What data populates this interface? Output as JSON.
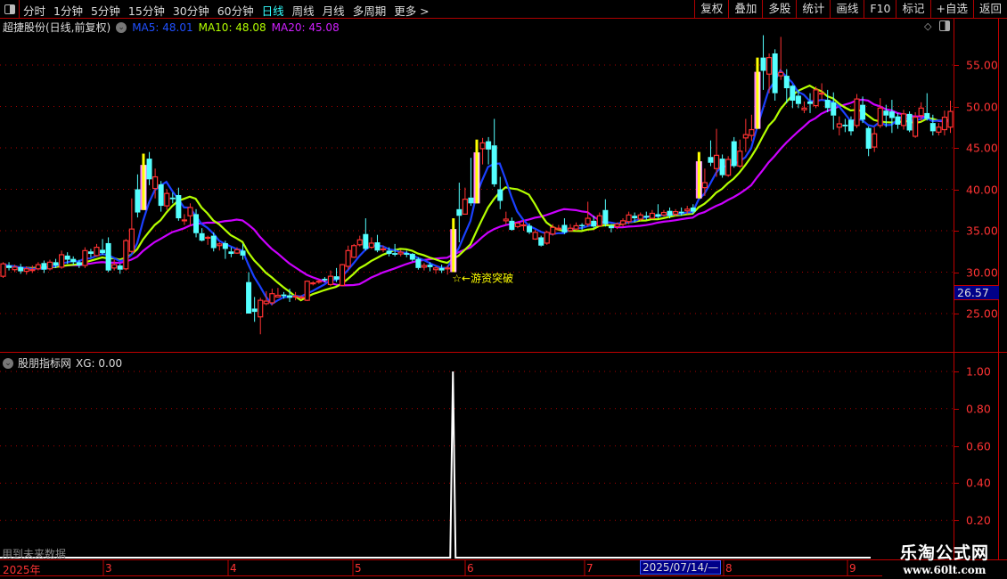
{
  "toolbar": {
    "periods": [
      "分时",
      "1分钟",
      "5分钟",
      "15分钟",
      "30分钟",
      "60分钟",
      "日线",
      "周线",
      "月线",
      "多周期",
      "更多 >"
    ],
    "active_period": "日线",
    "right_buttons": [
      "复权",
      "叠加",
      "多股",
      "统计",
      "画线",
      "F10",
      "标记",
      "+自选",
      "返回"
    ]
  },
  "main_panel": {
    "title": "超捷股份(日线,前复权)",
    "ma5": "MA5: 48.01",
    "ma10": "MA10: 48.08",
    "ma20": "MA20: 45.08",
    "signal_label": "☆←游资突破",
    "current_price": "26.57"
  },
  "sub_panel": {
    "title": "股朋指标网",
    "xg": "XG: 0.00",
    "future_note": "用到未来数据"
  },
  "colors": {
    "up": "#ff3232",
    "down": "#54ffff",
    "ma5": "#1a40ff",
    "ma10": "#b4ff00",
    "ma20": "#cc00ff",
    "signal": "#ffff00"
  },
  "watermark": {
    "title": "乐淘公式网",
    "url": "www.60lt.com"
  },
  "chart_data": [
    {
      "type": "candlestick",
      "title": "超捷股份(日线,前复权)",
      "yticks": [
        "55.00",
        "50.00",
        "45.00",
        "40.00",
        "35.00",
        "30.00",
        "25.00"
      ],
      "ylim": [
        20.8,
        58.8
      ],
      "grid": true,
      "series_names": [
        "MA5",
        "MA10",
        "MA20"
      ],
      "candles_ohlc_order": "open,close,high,low",
      "candles": [
        [
          29.5,
          31,
          31.2,
          29.3
        ],
        [
          30.8,
          30.5,
          31.2,
          30.2
        ],
        [
          30.3,
          30.6,
          30.9,
          30
        ],
        [
          30.6,
          30.1,
          31,
          29.8
        ],
        [
          30.1,
          30.4,
          30.7,
          29.7
        ],
        [
          30.3,
          30.3,
          30.8,
          29.9
        ],
        [
          30.4,
          30.9,
          31.2,
          30.2
        ],
        [
          31.1,
          30.3,
          31.4,
          29.9
        ],
        [
          30.4,
          31.2,
          31.5,
          30.2
        ],
        [
          31.2,
          30.8,
          31.6,
          30.5
        ],
        [
          30.6,
          32.1,
          32.6,
          30.4
        ],
        [
          32,
          31.5,
          32.4,
          31
        ],
        [
          31.6,
          31.2,
          31.9,
          30.9
        ],
        [
          31.2,
          30.8,
          31.5,
          30.5
        ],
        [
          30.8,
          32.6,
          33,
          30.5
        ],
        [
          32.5,
          32.2,
          32.8,
          31.8
        ],
        [
          32,
          33,
          33.4,
          31.9
        ],
        [
          32.7,
          32.3,
          34,
          32.1
        ],
        [
          33.5,
          30.2,
          34.2,
          30
        ],
        [
          30.5,
          30.9,
          31.5,
          30.2
        ],
        [
          30.8,
          30.3,
          31,
          29.8
        ],
        [
          30.4,
          33.8,
          34,
          30.2
        ],
        [
          32.5,
          35.2,
          38.9,
          32.3
        ],
        [
          40,
          37.2,
          41.8,
          36.6
        ],
        [
          37.5,
          44.3,
          44.6,
          37.3
        ],
        [
          43.7,
          41.2,
          44.5,
          40.5
        ],
        [
          40.1,
          41.5,
          42.5,
          38.9
        ],
        [
          40.6,
          38,
          41,
          37.3
        ],
        [
          38,
          39.5,
          40,
          37.5
        ],
        [
          39,
          38.8,
          39.6,
          38.3
        ],
        [
          39.3,
          36.5,
          40.2,
          36.2
        ],
        [
          36.2,
          36.3,
          37,
          35.7
        ],
        [
          36.8,
          37.8,
          38.3,
          35.6
        ],
        [
          37,
          34.7,
          37.6,
          34.2
        ],
        [
          34.7,
          33.8,
          35.3,
          33.7
        ],
        [
          34.2,
          34.2,
          34.4,
          33.3
        ],
        [
          34.4,
          32.9,
          34.8,
          32.5
        ],
        [
          33.2,
          33.4,
          33.6,
          32.6
        ],
        [
          33.5,
          32.8,
          33.8,
          31.6
        ],
        [
          32.5,
          32.2,
          33,
          31.8
        ],
        [
          32.3,
          32.7,
          33,
          32.2
        ],
        [
          32.6,
          32,
          33.4,
          31.5
        ],
        [
          28.8,
          25,
          30,
          25
        ],
        [
          25.6,
          25.2,
          27,
          24
        ],
        [
          24.6,
          26.6,
          26.9,
          22.5
        ],
        [
          26.2,
          26.5,
          27.7,
          26
        ],
        [
          26.3,
          27.4,
          28,
          26
        ],
        [
          27,
          27.2,
          28.1,
          27
        ],
        [
          27.3,
          27.1,
          27.6,
          26.8
        ],
        [
          27.2,
          26.9,
          28,
          26.4
        ],
        [
          27.1,
          27.1,
          27.6,
          26.6
        ],
        [
          26.9,
          27,
          27.2,
          26.7
        ],
        [
          26.6,
          28.9,
          29,
          26.5
        ],
        [
          28.6,
          28.7,
          28.9,
          28.4
        ],
        [
          28.9,
          28.9,
          29.1,
          28.6
        ],
        [
          29.2,
          29,
          29.4,
          28.8
        ],
        [
          28.5,
          29.5,
          30.2,
          28.3
        ],
        [
          29.5,
          29.1,
          30.5,
          28.8
        ],
        [
          28.4,
          30.9,
          31,
          28.3
        ],
        [
          30.7,
          32.6,
          33.2,
          30.3
        ],
        [
          31.8,
          33.2,
          33.4,
          31.7
        ],
        [
          33.3,
          33.9,
          34.4,
          33.1
        ],
        [
          34.6,
          32.8,
          36.5,
          32.6
        ],
        [
          33,
          33.5,
          34.2,
          32.8
        ],
        [
          33.6,
          32.6,
          34.5,
          32.4
        ],
        [
          32.7,
          32.8,
          33.2,
          32.4
        ],
        [
          32.6,
          32.2,
          33,
          31.9
        ],
        [
          32.3,
          32.1,
          33.4,
          31.9
        ],
        [
          32.2,
          32.4,
          32.7,
          31.9
        ],
        [
          32.3,
          32.1,
          32.6,
          31.8
        ],
        [
          32.2,
          31.5,
          32.3,
          31.3
        ],
        [
          31.6,
          30.5,
          31.8,
          30.3
        ],
        [
          30.6,
          30.8,
          31.1,
          30.2
        ],
        [
          30.9,
          30.6,
          31.2,
          30.1
        ],
        [
          30.3,
          30.5,
          30.7,
          29.8
        ],
        [
          30.5,
          30.2,
          30.9,
          29.9
        ],
        [
          30.4,
          30.5,
          30.8,
          29.7
        ],
        [
          30,
          36.5,
          36.5,
          29.8
        ],
        [
          37.6,
          36.8,
          40.8,
          33.6
        ],
        [
          37,
          38.8,
          40.2,
          37
        ],
        [
          39,
          38.3,
          43.8,
          38
        ],
        [
          38.3,
          46,
          46,
          38.3
        ],
        [
          44.9,
          45.6,
          46.2,
          43
        ],
        [
          45.8,
          44.8,
          46.3,
          43
        ],
        [
          45.3,
          40.6,
          48.5,
          40.3
        ],
        [
          40,
          38.6,
          41.5,
          37.6
        ],
        [
          36.2,
          36.4,
          37.3,
          35.8
        ],
        [
          36.2,
          35.1,
          36.6,
          35
        ],
        [
          35.5,
          35.9,
          36,
          35.3
        ],
        [
          35.7,
          35.7,
          36.3,
          35
        ],
        [
          35.6,
          34.8,
          35.9,
          34.6
        ],
        [
          34,
          34.8,
          35.1,
          33.9
        ],
        [
          34.2,
          33.2,
          34.4,
          33.1
        ],
        [
          33.5,
          34.8,
          35,
          33.3
        ],
        [
          34.6,
          35.4,
          35.8,
          34.4
        ],
        [
          35.2,
          35.3,
          35.7,
          35
        ],
        [
          35.7,
          34.8,
          36.5,
          34.6
        ],
        [
          35,
          35.3,
          35.8,
          34.9
        ],
        [
          35.2,
          35.6,
          36,
          35
        ],
        [
          35.7,
          35.6,
          35.9,
          35.1
        ],
        [
          35.8,
          36.5,
          38.5,
          35.5
        ],
        [
          36.2,
          35.5,
          36.8,
          35.3
        ],
        [
          35.6,
          36.8,
          37.2,
          35.5
        ],
        [
          37.5,
          35.8,
          38.8,
          35.5
        ],
        [
          35.6,
          35.3,
          35.8,
          34.8
        ],
        [
          35.5,
          35.8,
          36,
          35.2
        ],
        [
          35.8,
          36.2,
          36.5,
          35.5
        ],
        [
          36.1,
          36.9,
          37.3,
          35.8
        ],
        [
          36.8,
          36.5,
          37.2,
          36
        ],
        [
          36.4,
          36.9,
          37.2,
          36.2
        ],
        [
          36.8,
          36.6,
          37.3,
          36.3
        ],
        [
          36.5,
          37.1,
          37.5,
          36.4
        ],
        [
          37,
          36.7,
          38.2,
          36.5
        ],
        [
          36.9,
          37.2,
          37.5,
          36.7
        ],
        [
          37.4,
          36.8,
          37.8,
          36.5
        ],
        [
          37,
          37.3,
          37.6,
          36.7
        ],
        [
          37.3,
          37.1,
          37.8,
          36.8
        ],
        [
          37.4,
          37.6,
          38,
          37
        ],
        [
          37.8,
          37.3,
          38.2,
          37
        ],
        [
          38.9,
          44.5,
          44.5,
          38.9
        ],
        [
          40.2,
          40.8,
          42.5,
          39.2
        ],
        [
          43.9,
          43.2,
          45.9,
          42.8
        ],
        [
          42.5,
          44.1,
          47.3,
          41.5
        ],
        [
          43.7,
          41.7,
          44.2,
          41.4
        ],
        [
          41.7,
          43.6,
          44,
          41.5
        ],
        [
          45.8,
          42.8,
          46.3,
          42.6
        ],
        [
          42.8,
          44.6,
          46,
          42.6
        ],
        [
          46.2,
          46.6,
          48.5,
          44.5
        ],
        [
          46.5,
          47.2,
          49,
          45.8
        ],
        [
          47.3,
          55.9,
          55.9,
          47.3
        ],
        [
          55.9,
          54.3,
          58.6,
          52
        ],
        [
          53.9,
          55.9,
          56.4,
          51.6
        ],
        [
          56.4,
          51.6,
          56.9,
          50.7
        ],
        [
          53.7,
          54.1,
          58.4,
          53.2
        ],
        [
          53.7,
          52.2,
          54.5,
          50.4
        ],
        [
          52.5,
          50.7,
          52.6,
          49.8
        ],
        [
          51.3,
          50.3,
          52,
          49.8
        ],
        [
          49.6,
          49.8,
          50.6,
          49.2
        ],
        [
          50.6,
          50.3,
          51.6,
          49.2
        ],
        [
          50.1,
          52,
          52.4,
          49.8
        ],
        [
          51.5,
          51.6,
          52.8,
          50.8
        ],
        [
          50.8,
          49.8,
          52,
          49.3
        ],
        [
          50.5,
          48.9,
          51.7,
          47.2
        ],
        [
          47.5,
          47.9,
          48.8,
          46.5
        ],
        [
          47.8,
          47.6,
          48.5,
          46.9
        ],
        [
          48.4,
          47,
          48.8,
          46.5
        ],
        [
          47.7,
          50.9,
          51.5,
          47.4
        ],
        [
          50.2,
          48.4,
          51.2,
          48
        ],
        [
          47.4,
          44.9,
          47.6,
          44
        ],
        [
          45.1,
          46.7,
          47.5,
          44.5
        ],
        [
          47.7,
          49.8,
          51,
          47.4
        ],
        [
          49.5,
          48.9,
          50.2,
          47.5
        ],
        [
          49.4,
          48.6,
          50.8,
          46.8
        ],
        [
          48.8,
          47.8,
          49.2,
          47.3
        ],
        [
          47.7,
          49.1,
          49.6,
          47.2
        ],
        [
          49.1,
          47.1,
          49.4,
          46.9
        ],
        [
          46.4,
          48.7,
          49.3,
          46.2
        ],
        [
          48.9,
          49.8,
          50.5,
          48.2
        ],
        [
          49.2,
          48.5,
          51.6,
          48.3
        ],
        [
          48,
          47,
          49,
          46.5
        ],
        [
          46.9,
          47.5,
          48,
          46.5
        ],
        [
          47.2,
          48.7,
          49.5,
          46.5
        ],
        [
          47.5,
          49.4,
          50.7,
          46.8
        ]
      ],
      "highlight_bars": [
        24,
        77,
        81,
        119,
        129
      ],
      "signal_index": 77
    },
    {
      "type": "line",
      "title": "股朋指标网",
      "series_names": [
        "XG"
      ],
      "yticks": [
        "1.00",
        "0.80",
        "0.60",
        "0.40",
        "0.20"
      ],
      "ylim": [
        0,
        1.05
      ],
      "spike_index": 77,
      "spike_value": 1.0,
      "baseline": 0
    }
  ],
  "xaxis": {
    "labels": [
      "2025年",
      "3",
      "4",
      "5",
      "6",
      "7",
      "8",
      "9"
    ],
    "cursor_date": "2025/07/14/—"
  }
}
